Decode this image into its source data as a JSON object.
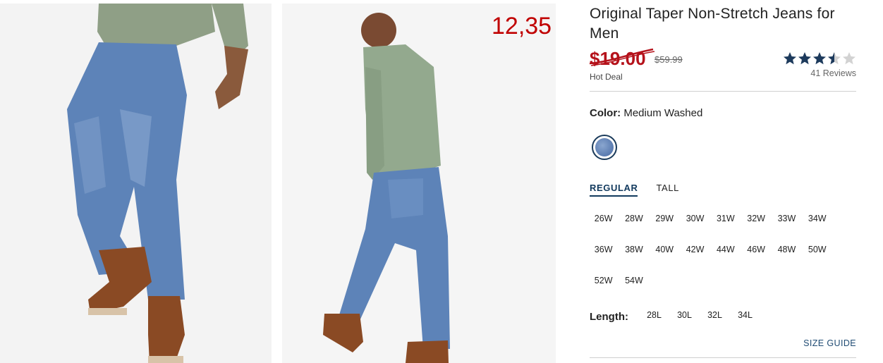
{
  "overlay_price": "12,35",
  "product": {
    "title": "Original Taper Non-Stretch Jeans for Men",
    "sale_price": "$19.00",
    "original_price": "$59.99",
    "deal_label": "Hot Deal",
    "rating": 3.5,
    "rating_max": 5,
    "reviews": "41 Reviews"
  },
  "color": {
    "label": "Color:",
    "value": "Medium Washed",
    "swatch_hex": "#6a89bd"
  },
  "fit_tabs": [
    {
      "label": "REGULAR",
      "active": true
    },
    {
      "label": "TALL",
      "active": false
    }
  ],
  "sizes": [
    "26W",
    "28W",
    "29W",
    "30W",
    "31W",
    "32W",
    "33W",
    "34W",
    "36W",
    "38W",
    "40W",
    "42W",
    "44W",
    "46W",
    "48W",
    "50W",
    "52W",
    "54W"
  ],
  "length": {
    "label": "Length:",
    "options": [
      "28L",
      "30L",
      "32L",
      "34L"
    ]
  },
  "size_guide": "SIZE GUIDE",
  "colors": {
    "sale_red": "#b5121b",
    "overlay_red": "#c00000",
    "navy": "#123a5e",
    "star_navy": "#1d3a5c"
  }
}
